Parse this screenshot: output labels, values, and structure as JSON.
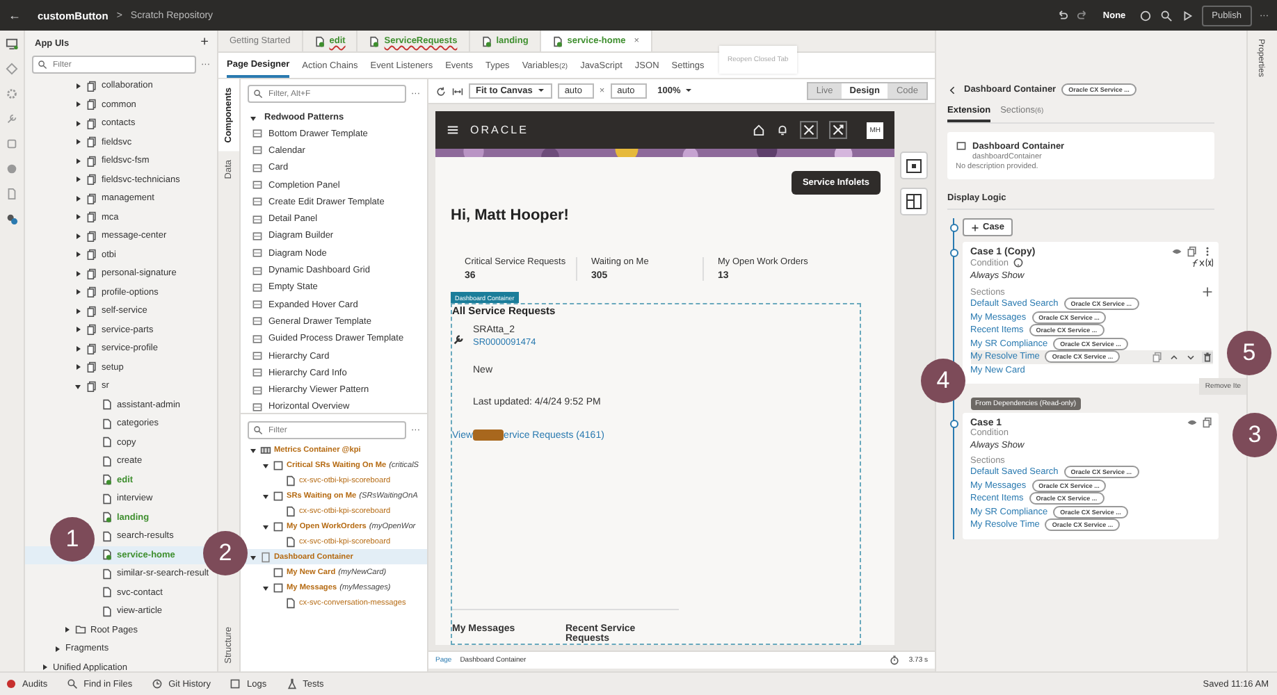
{
  "top_bar": {
    "back": "←",
    "app": "customButton",
    "separator": ">",
    "repository": "Scratch Repository",
    "scheme": "None",
    "publish": "Publish",
    "more": "···"
  },
  "app_uis": {
    "title": "App UIs",
    "add": "+",
    "filter_placeholder": "Filter",
    "more": "···",
    "tree": [
      {
        "label": "collaboration",
        "kind": "folder",
        "expanded": false,
        "selected": false
      },
      {
        "label": "common",
        "kind": "folder",
        "expanded": false,
        "selected": false
      },
      {
        "label": "contacts",
        "kind": "folder",
        "expanded": false,
        "selected": false
      },
      {
        "label": "fieldsvc",
        "kind": "folder",
        "expanded": false,
        "selected": false
      },
      {
        "label": "fieldsvc-fsm",
        "kind": "folder",
        "expanded": false,
        "selected": false
      },
      {
        "label": "fieldsvc-technicians",
        "kind": "folder",
        "expanded": false,
        "selected": false
      },
      {
        "label": "management",
        "kind": "folder",
        "expanded": false,
        "selected": false
      },
      {
        "label": "mca",
        "kind": "folder",
        "expanded": false,
        "selected": false
      },
      {
        "label": "message-center",
        "kind": "folder",
        "expanded": false,
        "selected": false
      },
      {
        "label": "otbi",
        "kind": "folder",
        "expanded": false,
        "selected": false
      },
      {
        "label": "personal-signature",
        "kind": "folder",
        "expanded": false,
        "selected": false
      },
      {
        "label": "profile-options",
        "kind": "folder",
        "expanded": false,
        "selected": false
      },
      {
        "label": "self-service",
        "kind": "folder",
        "expanded": false,
        "selected": false
      },
      {
        "label": "service-parts",
        "kind": "folder",
        "expanded": false,
        "selected": false
      },
      {
        "label": "service-profile",
        "kind": "folder",
        "expanded": false,
        "selected": false
      },
      {
        "label": "setup",
        "kind": "folder",
        "expanded": false,
        "selected": false
      },
      {
        "label": "sr",
        "kind": "folder",
        "expanded": true,
        "selected": false,
        "children": [
          {
            "label": "assistant-admin",
            "kind": "page",
            "modified": false,
            "selected": false
          },
          {
            "label": "categories",
            "kind": "page",
            "modified": false,
            "selected": false
          },
          {
            "label": "copy",
            "kind": "page",
            "modified": false,
            "selected": false
          },
          {
            "label": "create",
            "kind": "page",
            "modified": false,
            "selected": false
          },
          {
            "label": "edit",
            "kind": "page",
            "modified": true,
            "selected": false
          },
          {
            "label": "interview",
            "kind": "page",
            "modified": false,
            "selected": false
          },
          {
            "label": "landing",
            "kind": "page",
            "modified": true,
            "selected": false
          },
          {
            "label": "search-results",
            "kind": "page",
            "modified": false,
            "selected": false
          },
          {
            "label": "service-home",
            "kind": "page",
            "modified": true,
            "selected": true
          },
          {
            "label": "similar-sr-search-result",
            "kind": "page",
            "modified": false,
            "selected": false
          },
          {
            "label": "svc-contact",
            "kind": "page",
            "modified": false,
            "selected": false
          },
          {
            "label": "view-article",
            "kind": "page",
            "modified": false,
            "selected": false
          }
        ]
      },
      {
        "label": "Root Pages",
        "kind": "root-folder",
        "expanded": false,
        "selected": false
      },
      {
        "label": "Fragments",
        "kind": "section",
        "expanded": false,
        "selected": false
      },
      {
        "label": "Unified Application",
        "kind": "app",
        "expanded": false,
        "selected": false
      }
    ]
  },
  "editor_tabs": [
    {
      "label": "Getting Started",
      "page_icon": false,
      "flagged": false,
      "selected": false
    },
    {
      "label": "edit",
      "page_icon": true,
      "flagged": true,
      "selected": false
    },
    {
      "label": "ServiceRequests",
      "page_icon": true,
      "flagged": true,
      "selected": false
    },
    {
      "label": "landing",
      "page_icon": true,
      "flagged": false,
      "selected": false
    },
    {
      "label": "service-home",
      "page_icon": true,
      "flagged": false,
      "selected": true,
      "close": "×"
    }
  ],
  "tab_tooltip": "Reopen Closed Tab",
  "designer_tabs": [
    {
      "label": "Page Designer",
      "selected": true
    },
    {
      "label": "Action Chains",
      "selected": false
    },
    {
      "label": "Event Listeners",
      "selected": false
    },
    {
      "label": "Events",
      "selected": false
    },
    {
      "label": "Types",
      "selected": false
    },
    {
      "label": "Variables",
      "count": "(2)",
      "selected": false
    },
    {
      "label": "JavaScript",
      "selected": false
    },
    {
      "label": "JSON",
      "selected": false
    },
    {
      "label": "Settings",
      "selected": false
    }
  ],
  "side_tabs": [
    {
      "label": "Components",
      "selected": true
    },
    {
      "label": "Data",
      "selected": false
    },
    {
      "label": "Structure",
      "selected": false
    }
  ],
  "palette": {
    "filter_placeholder": "Filter, Alt+F",
    "more": "···",
    "group": "Redwood Patterns",
    "expanded": true,
    "items": [
      "Bottom Drawer Template",
      "Calendar",
      "Card",
      "Completion Panel",
      "Create Edit Drawer Template",
      "Detail Panel",
      "Diagram Builder",
      "Diagram Node",
      "Dynamic Dashboard Grid",
      "Empty State",
      "Expanded Hover Card",
      "General Drawer Template",
      "Guided Process Drawer Template",
      "Hierarchy Card",
      "Hierarchy Card Info",
      "Hierarchy Viewer Pattern",
      "Horizontal Overview"
    ]
  },
  "structure": {
    "filter_placeholder": "Filter",
    "more": "···",
    "tree": [
      {
        "name": "Metrics Container @kpi",
        "kind": "container",
        "expanded": true,
        "selected": false,
        "children": [
          {
            "name": "Critical SRs Waiting On Me",
            "id": "(criticalS",
            "kind": "box",
            "expanded": true,
            "selected": false,
            "children": [
              {
                "name": "cx-svc-otbi-kpi-scoreboard",
                "kind": "element",
                "selected": false
              }
            ]
          },
          {
            "name": "SRs Waiting on Me",
            "id": "(SRsWaitingOnA",
            "kind": "box",
            "expanded": true,
            "selected": false,
            "children": [
              {
                "name": "cx-svc-otbi-kpi-scoreboard",
                "kind": "element",
                "selected": false
              }
            ]
          },
          {
            "name": "My Open WorkOrders",
            "id": "(myOpenWor",
            "kind": "box",
            "expanded": true,
            "selected": false,
            "children": [
              {
                "name": "cx-svc-otbi-kpi-scoreboard",
                "kind": "element",
                "selected": false
              }
            ]
          }
        ]
      },
      {
        "name": "Dashboard Container",
        "kind": "dashboard",
        "expanded": true,
        "selected": true,
        "children": [
          {
            "name": "My New Card",
            "id": "(myNewCard)",
            "kind": "box",
            "selected": false
          },
          {
            "name": "My Messages",
            "id": "(myMessages)",
            "kind": "box",
            "expanded": true,
            "selected": false,
            "children": [
              {
                "name": "cx-svc-conversation-messages",
                "kind": "element",
                "selected": false
              }
            ]
          }
        ]
      }
    ]
  },
  "canvas_toolbar": {
    "fit": "Fit to Canvas",
    "width": "auto",
    "times": "×",
    "height": "auto",
    "zoom": "100%",
    "modes": [
      {
        "label": "Live",
        "selected": false
      },
      {
        "label": "Design",
        "selected": true
      },
      {
        "label": "Code",
        "selected": false
      }
    ]
  },
  "preview": {
    "brand": "ORACLE",
    "avatar": "MH",
    "infolets_button": "Service Infolets",
    "greeting": "Hi, Matt Hooper!",
    "kpis": [
      {
        "label": "Critical Service Requests",
        "value": "36"
      },
      {
        "label": "Waiting on Me",
        "value": "305"
      },
      {
        "label": "My Open Work Orders",
        "value": "13"
      }
    ],
    "container_tag": "Dashboard Container",
    "section_title": "All Service Requests",
    "request": {
      "title": "SRAtta_2",
      "number": "SR0000091474",
      "status": "New",
      "updated": "Last updated: 4/4/24 9:52 PM"
    },
    "link_before": "View",
    "link_after": "ervice Requests (4161)",
    "bottom_titles": [
      "My Messages",
      "Recent Service Requests"
    ]
  },
  "breadcrumb": [
    "Page",
    "Dashboard Container"
  ],
  "timing": "3.73 s",
  "properties": {
    "title": "Dashboard Container",
    "chip": "Oracle CX Service ...",
    "tabs": [
      {
        "label": "Extension",
        "selected": true
      },
      {
        "label": "Sections",
        "count": "(6)",
        "selected": false
      }
    ],
    "card": {
      "title": "Dashboard Container",
      "id": "dashboardContainer",
      "description": "No description provided."
    },
    "display_logic": "Display Logic",
    "add_case": "Case",
    "cases": [
      {
        "title": "Case 1 (Copy)",
        "editable": true,
        "condition_label": "Condition",
        "condition": "Always Show",
        "sections_label": "Sections",
        "sections": [
          {
            "name": "Default Saved Search",
            "chip": "Oracle CX Service ...",
            "hovered": false
          },
          {
            "name": "My Messages",
            "chip": "Oracle CX Service ...",
            "hovered": false
          },
          {
            "name": "Recent Items",
            "chip": "Oracle CX Service ...",
            "hovered": false
          },
          {
            "name": "My SR Compliance",
            "chip": "Oracle CX Service ...",
            "hovered": false
          },
          {
            "name": "My Resolve Time",
            "chip": "Oracle CX Service ...",
            "hovered": true
          },
          {
            "name": "My New Card",
            "hovered": false
          }
        ]
      },
      {
        "title": "Case 1",
        "editable": false,
        "banner": "From Dependencies (Read-only)",
        "condition_label": "Condition",
        "condition": "Always Show",
        "sections_label": "Sections",
        "sections": [
          {
            "name": "Default Saved Search",
            "chip": "Oracle CX Service ...",
            "hovered": false
          },
          {
            "name": "My Messages",
            "chip": "Oracle CX Service ...",
            "hovered": false
          },
          {
            "name": "Recent Items",
            "chip": "Oracle CX Service ...",
            "hovered": false
          },
          {
            "name": "My SR Compliance",
            "chip": "Oracle CX Service ...",
            "hovered": false
          },
          {
            "name": "My Resolve Time",
            "chip": "Oracle CX Service ...",
            "hovered": false
          }
        ]
      }
    ],
    "tooltip": "Remove Ite"
  },
  "properties_rail": "Properties",
  "status_bar": {
    "items": [
      "Audits",
      "Find in Files",
      "Git History",
      "Logs",
      "Tests"
    ],
    "saved": "Saved 11:16 AM"
  },
  "callouts": [
    "1",
    "2",
    "3",
    "4",
    "5"
  ]
}
